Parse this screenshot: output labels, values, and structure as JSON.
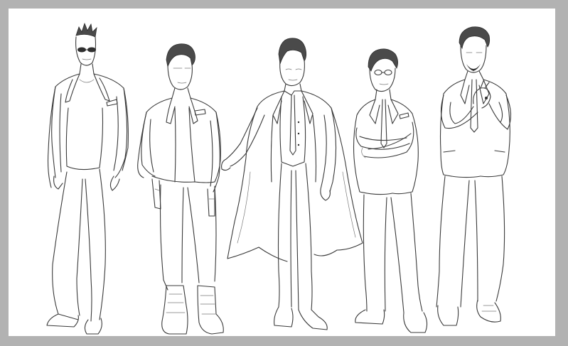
{
  "canvas": {
    "background": "#ffffff",
    "border_color": "#b2b2b2",
    "line_color": "#3a3a3a"
  },
  "figures": [
    {
      "icon": "man-figure-icon",
      "note": "figure-1"
    },
    {
      "icon": "man-figure-icon",
      "note": "figure-2"
    },
    {
      "icon": "man-figure-icon",
      "note": "figure-3"
    },
    {
      "icon": "man-figure-icon",
      "note": "figure-4"
    },
    {
      "icon": "man-figure-icon",
      "note": "figure-5"
    }
  ]
}
